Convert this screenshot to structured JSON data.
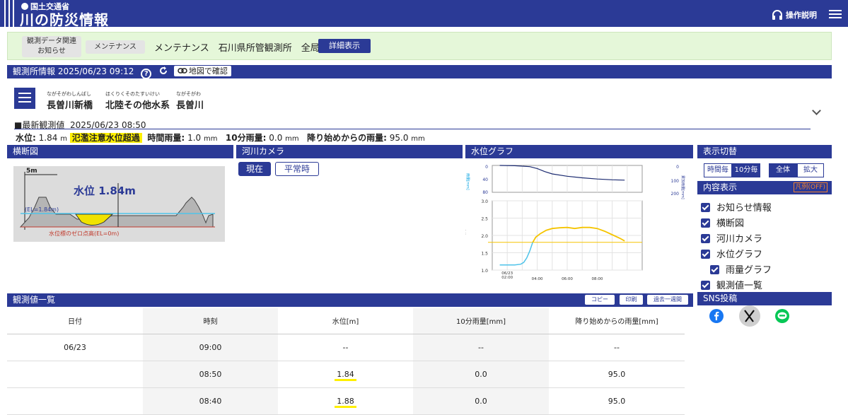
{
  "header": {
    "ministry": "国土交通省",
    "title": "川の防災情報",
    "help_label": "操作説明"
  },
  "notice": {
    "tag1_line1": "観測データ関連",
    "tag1_line2": "お知らせ",
    "tag2": "メンテナンス",
    "text": "メンテナンス　石川県所管観測所　全局",
    "detail_button": "詳細表示"
  },
  "station": {
    "bar_title": "観測所情報 2025/06/23 09:12",
    "map_button": "地図で確認",
    "names": [
      {
        "ruby": "ながそがわしんばし",
        "text": "長曽川新橋"
      },
      {
        "ruby": "ほくりくそのたすいけい",
        "text": "北陸その他水系"
      },
      {
        "ruby": "ながそがわ",
        "text": "長曽川"
      }
    ],
    "latest_label": "■最新観測値",
    "latest_time": "2025/06/23 08:50",
    "water_level_label": "水位:",
    "water_level_value": "1.84",
    "water_level_unit": "m",
    "warning": "氾濫注意水位超過",
    "hourly_rain_label": "時間雨量:",
    "hourly_rain_value": "1.0",
    "hourly_rain_unit": "mm",
    "tenmin_rain_label": "10分雨量:",
    "tenmin_rain_value": "0.0",
    "tenmin_rain_unit": "mm",
    "total_rain_label": "降り始めからの雨量:",
    "total_rain_value": "95.0",
    "total_rain_unit": "mm"
  },
  "cross_section": {
    "title": "横断図",
    "scale_label": "5m",
    "level_text": "水位 1.84m",
    "el_label": "(EL=1.84m)",
    "zero_label": "水位標のゼロ点高(EL=0m)"
  },
  "camera": {
    "title": "河川カメラ",
    "tab_now": "現在",
    "tab_normal": "平常時"
  },
  "water_graph": {
    "title": "水位グラフ"
  },
  "display": {
    "title": "表示切替",
    "hourly": "時間毎",
    "tenmin": "10分毎",
    "all": "全体",
    "zoom": "拡大",
    "content_title": "内容表示",
    "legend_button": "凡例(OFF)",
    "items": [
      "お知らせ情報",
      "横断図",
      "河川カメラ",
      "水位グラフ",
      "雨量グラフ",
      "観測値一覧"
    ],
    "sns_title": "SNS投稿"
  },
  "obs_list": {
    "title": "観測値一覧",
    "copy": "コピー",
    "print": "印刷",
    "past_week": "過去一週間",
    "headers": [
      "日付",
      "時刻",
      "水位[m]",
      "10分雨量[mm]",
      "降り始めからの雨量[mm]"
    ],
    "rows": [
      [
        "06/23",
        "09:00",
        "--",
        "--",
        "--"
      ],
      [
        "",
        "08:50",
        "1.84",
        "0.0",
        "95.0"
      ],
      [
        "",
        "08:40",
        "1.88",
        "0.0",
        "95.0"
      ]
    ]
  },
  "chart_data": {
    "type": "line",
    "rain_axis_left_label": "雨量[mm]",
    "rain_axis_right_label": "累加雨量[mm]",
    "rain_axis_left_ticks": [
      "0",
      "40",
      "80"
    ],
    "rain_axis_right_ticks": [
      "0",
      "100",
      "200"
    ],
    "level_axis_label": "水位[m]",
    "level_ticks": [
      "3.0",
      "2.5",
      "2.0",
      "1.5",
      "1.0"
    ],
    "x_ticks": [
      "06/23\n02:00",
      "04:00",
      "06:00",
      "08:00"
    ],
    "level_ylim": [
      1.0,
      3.0
    ],
    "warning_level": 1.8,
    "series": [
      {
        "x": [
          0.5,
          1.0,
          1.5,
          1.9,
          2.1,
          2.3,
          2.5,
          2.7,
          2.9,
          3.2,
          3.6,
          4.0,
          4.5,
          5.0,
          5.5,
          6.0,
          6.5,
          7.0,
          7.5,
          8.0,
          8.5,
          8.83
        ],
        "values": [
          1.15,
          1.15,
          1.15,
          1.17,
          1.22,
          1.35,
          1.55,
          1.8,
          1.95,
          2.05,
          2.15,
          2.2,
          2.22,
          2.23,
          2.2,
          2.23,
          2.23,
          2.2,
          2.12,
          2.02,
          1.92,
          1.84
        ]
      },
      {
        "x": [
          0.5,
          1.5,
          2.5,
          3.0,
          3.5,
          4.0,
          5.0,
          6.0,
          7.0,
          8.0,
          8.83
        ],
        "values": [
          0,
          2,
          8,
          20,
          40,
          55,
          70,
          80,
          88,
          93,
          95
        ]
      }
    ]
  }
}
